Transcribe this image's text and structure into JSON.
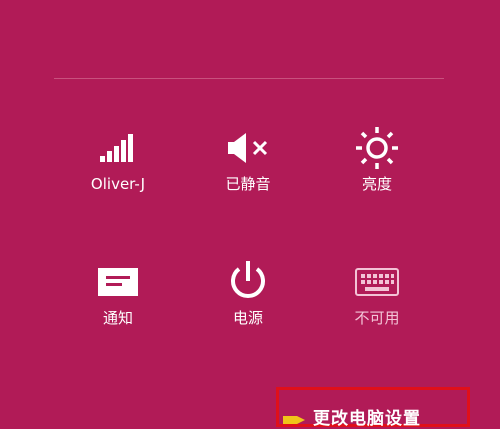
{
  "colors": {
    "background": "#b11b57",
    "highlight_border": "#e0101a",
    "disabled_text": "#f3c3d6"
  },
  "tiles": [
    {
      "icon": "signal-bars-icon",
      "label": "Oliver-J"
    },
    {
      "icon": "speaker-muted-icon",
      "label": "已静音"
    },
    {
      "icon": "sun-icon",
      "label": "亮度"
    },
    {
      "icon": "notification-icon",
      "label": "通知"
    },
    {
      "icon": "power-icon",
      "label": "电源"
    },
    {
      "icon": "keyboard-icon",
      "label": "不可用"
    }
  ],
  "change_settings": {
    "label": "更改电脑设置"
  }
}
